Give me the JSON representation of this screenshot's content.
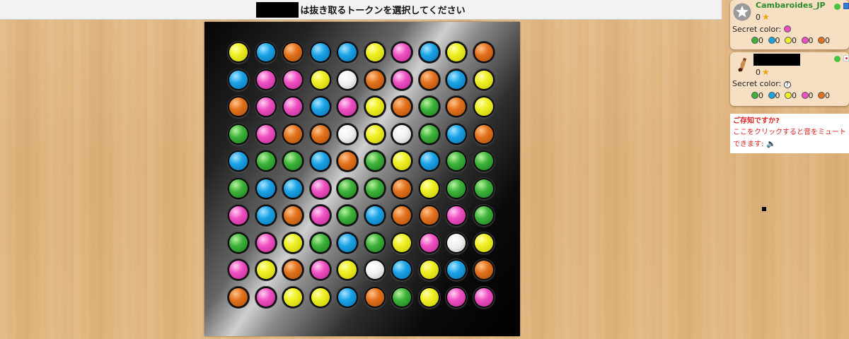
{
  "topbar": {
    "message": "は抜き取るトークンを選択してください"
  },
  "board": {
    "rows": [
      [
        "yellow",
        "blue",
        "orange",
        "blue",
        "blue",
        "yellow",
        "pink",
        "blue",
        "yellow",
        "orange"
      ],
      [
        "blue",
        "pink",
        "pink",
        "yellow",
        "white",
        "orange",
        "pink",
        "orange",
        "blue",
        "yellow"
      ],
      [
        "orange",
        "pink",
        "pink",
        "blue",
        "pink",
        "yellow",
        "orange",
        "green",
        "orange",
        "yellow"
      ],
      [
        "green",
        "pink",
        "orange",
        "orange",
        "white",
        "yellow",
        "white",
        "green",
        "blue",
        "orange"
      ],
      [
        "blue",
        "green",
        "green",
        "blue",
        "orange",
        "green",
        "yellow",
        "blue",
        "green",
        "green"
      ],
      [
        "green",
        "blue",
        "blue",
        "pink",
        "green",
        "green",
        "orange",
        "yellow",
        "green",
        "green"
      ],
      [
        "pink",
        "blue",
        "orange",
        "pink",
        "green",
        "blue",
        "orange",
        "orange",
        "pink",
        "green"
      ],
      [
        "green",
        "pink",
        "yellow",
        "green",
        "blue",
        "green",
        "yellow",
        "pink",
        "white",
        "yellow"
      ],
      [
        "pink",
        "yellow",
        "orange",
        "pink",
        "yellow",
        "white",
        "blue",
        "yellow",
        "blue",
        "orange"
      ],
      [
        "orange",
        "pink",
        "yellow",
        "yellow",
        "blue",
        "orange",
        "green",
        "yellow",
        "pink",
        "pink"
      ]
    ]
  },
  "players": [
    {
      "name": "Cambaroides_JP",
      "score": "0",
      "secret_label": "Secret color:",
      "secret_color": "pink",
      "counts": [
        {
          "color": "green",
          "value": "0"
        },
        {
          "color": "blue",
          "value": "0"
        },
        {
          "color": "yellow",
          "value": "0"
        },
        {
          "color": "pink",
          "value": "0"
        },
        {
          "color": "orange",
          "value": "0"
        }
      ]
    },
    {
      "name": "",
      "score": "0",
      "secret_label": "Secret color:",
      "secret_color": "unknown",
      "counts": [
        {
          "color": "green",
          "value": "0"
        },
        {
          "color": "blue",
          "value": "0"
        },
        {
          "color": "yellow",
          "value": "0"
        },
        {
          "color": "pink",
          "value": "0"
        },
        {
          "color": "orange",
          "value": "0"
        }
      ]
    }
  ],
  "tip": {
    "title": "ご存知ですか?",
    "line1": "ここをクリックすると音をミュート",
    "line2": "できます:"
  },
  "colors": {
    "green": "#3db33a",
    "blue": "#1aa3e6",
    "yellow": "#f1f12a",
    "pink": "#ef4fc2",
    "orange": "#e2711c",
    "white": "#f1f1f1"
  }
}
